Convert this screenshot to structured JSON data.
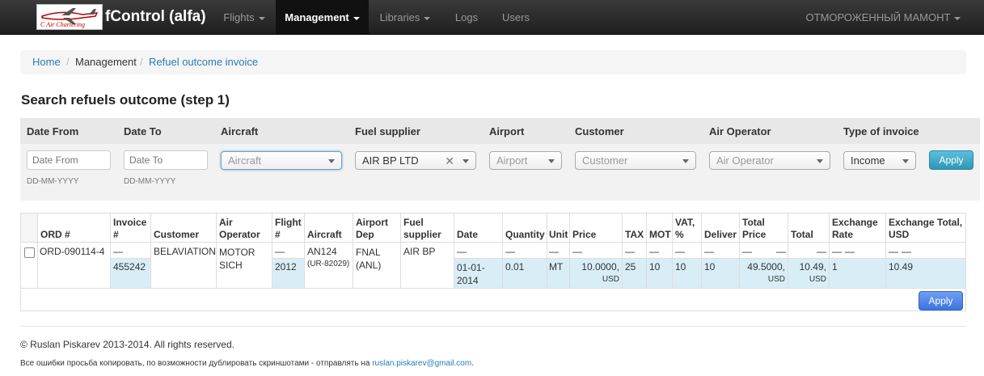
{
  "navbar": {
    "logo_text": "C Air Chartering",
    "title": "fControl (alfa)",
    "items": [
      {
        "label": "Flights",
        "active": false
      },
      {
        "label": "Management",
        "active": true
      },
      {
        "label": "Libraries",
        "active": false
      },
      {
        "label": "Logs",
        "active": false
      },
      {
        "label": "Users",
        "active": false
      }
    ],
    "user": "ОТМОРОЖЕННЫЙ МАМОНТ"
  },
  "breadcrumb": {
    "home": "Home",
    "management": "Management",
    "current": "Refuel outcome invoice",
    "separator": "/"
  },
  "page_title": "Search refuels outcome (step 1)",
  "filters": {
    "labels": {
      "date_from": "Date From",
      "date_to": "Date To",
      "aircraft": "Aircraft",
      "fuel_supplier": "Fuel supplier",
      "airport": "Airport",
      "customer": "Customer",
      "air_operator": "Air Operator",
      "type_of_invoice": "Type of invoice"
    },
    "date_from_placeholder": "Date From",
    "date_to_placeholder": "Date To",
    "date_hint": "DD-MM-YYYY",
    "aircraft_placeholder": "Aircraft",
    "fuel_supplier_value": "AIR BP LTD",
    "airport_placeholder": "Airport",
    "customer_placeholder": "Customer",
    "air_operator_placeholder": "Air Operator",
    "type_of_invoice_value": "Income",
    "apply_label": "Apply"
  },
  "table": {
    "headers": {
      "ord": "ORD #",
      "invoice": [
        "Invoice",
        "#"
      ],
      "customer": "Customer",
      "air_operator": [
        "Air",
        "Operator"
      ],
      "flight": [
        "Flight",
        "#"
      ],
      "aircraft": "Aircraft",
      "airport_dep": [
        "Airport",
        "Dep"
      ],
      "fuel_supplier": [
        "Fuel",
        "supplier"
      ],
      "date": "Date",
      "quantity": "Quantity",
      "unit": "Unit",
      "price": "Price",
      "tax": "TAX",
      "mot": "MOT",
      "vat": [
        "VAT,",
        "%"
      ],
      "deliver": "Deliver",
      "total_price": [
        "Total",
        "Price"
      ],
      "total": "Total",
      "exchange_rate": [
        "Exchange",
        "Rate"
      ],
      "exchange_total": [
        "Exchange Total,",
        "USD"
      ]
    },
    "dash": "—",
    "row": {
      "ord": "ORD-090114-4",
      "invoice": "455242",
      "customer": "BELAVIATION",
      "air_operator": [
        "MOTOR",
        "SICH"
      ],
      "flight": "2012",
      "aircraft": "AN124",
      "aircraft_reg": "(UR-82029)",
      "airport_dep": [
        "FNAL",
        "(ANL)"
      ],
      "fuel_supplier": "AIR BP",
      "date": [
        "01-01-",
        "2014"
      ],
      "quantity": "0.01",
      "unit": "MT",
      "price": "10.0000,",
      "price_currency": "USD",
      "tax": "25",
      "mot": "10",
      "vat": "10",
      "deliver": "10",
      "total_price": "49.5000,",
      "total_price_currency": "USD",
      "total": "10.49,",
      "total_currency": "USD",
      "exchange_rate": "1",
      "exchange_total": "10.49"
    },
    "apply_label": "Apply"
  },
  "footer": {
    "copyright": "© Ruslan Piskarev 2013-2014. All rights reserved.",
    "note": "Все ошибки просьба копировать, по возможности дублировать скриншотами - отправлять на",
    "email": "ruslan.piskarev@gmail.com",
    "period": "."
  }
}
